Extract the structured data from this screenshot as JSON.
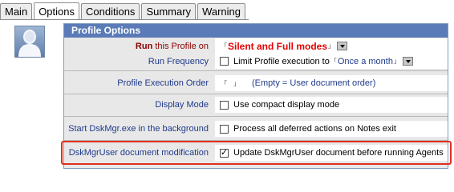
{
  "tabs": [
    "Main",
    "Options",
    "Conditions",
    "Summary",
    "Warning"
  ],
  "active_tab": "Options",
  "panel_title": "Profile Options",
  "rows": {
    "run_on": {
      "label_strong": "Run",
      "label_rest": " this Profile on",
      "value": "Silent and Full modes"
    },
    "run_frequency": {
      "label": "Run Frequency",
      "checkbox_label": "Limit Profile execution to",
      "value": "Once a month"
    },
    "execution_order": {
      "label": "Profile Execution Order",
      "hint": "(Empty = User document order)"
    },
    "display_mode": {
      "label": "Display Mode",
      "checkbox_label": "Use compact display mode"
    },
    "background": {
      "label": "Start DskMgr.exe in the background",
      "checkbox_label": "Process all deferred actions on Notes exit"
    },
    "doc_mod": {
      "label": "DskMgrUser document modification",
      "checkbox_label": "Update DskMgrUser document before running Agents",
      "checked": true
    }
  },
  "icons": {
    "avatar": "user-avatar-icon",
    "dropdown": "dropdown-arrow-icon"
  },
  "colors": {
    "panel_header": "#5a7bb7",
    "label_blue": "#1f3a8a",
    "value_red": "#e60000",
    "highlight": "#e0301e"
  }
}
